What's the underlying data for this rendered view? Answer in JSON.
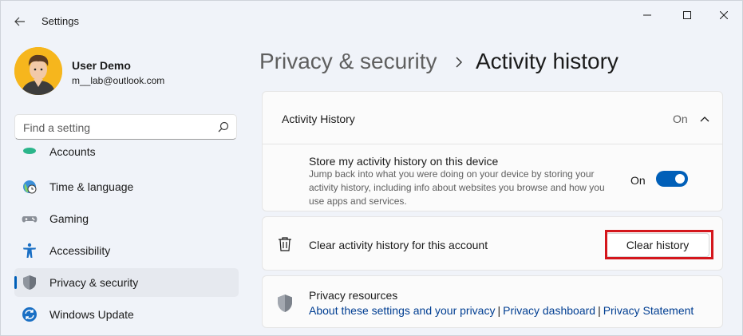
{
  "window": {
    "title": "Settings"
  },
  "profile": {
    "name": "User Demo",
    "email": "m__lab@outlook.com"
  },
  "search": {
    "placeholder": "Find a setting",
    "value": ""
  },
  "sidebar": {
    "items": [
      {
        "label": "Accounts",
        "icon": "accounts-icon",
        "selected": false
      },
      {
        "label": "Time & language",
        "icon": "time-language-icon",
        "selected": false
      },
      {
        "label": "Gaming",
        "icon": "gaming-icon",
        "selected": false
      },
      {
        "label": "Accessibility",
        "icon": "accessibility-icon",
        "selected": false
      },
      {
        "label": "Privacy & security",
        "icon": "shield-icon",
        "selected": true
      },
      {
        "label": "Windows Update",
        "icon": "windows-update-icon",
        "selected": false
      }
    ]
  },
  "breadcrumb": {
    "parent": "Privacy & security",
    "current": "Activity history"
  },
  "activity_section": {
    "title": "Activity History",
    "status": "On",
    "expanded": true
  },
  "store_setting": {
    "title": "Store my activity history on this device",
    "description": "Jump back into what you were doing on your device by storing your activity history, including info about websites you browse and how you use apps and services.",
    "toggle_label": "On",
    "enabled": true
  },
  "clear_setting": {
    "title": "Clear activity history for this account",
    "button_label": "Clear history"
  },
  "privacy_resources": {
    "title": "Privacy resources",
    "links": [
      "About these settings and your privacy",
      "Privacy dashboard",
      "Privacy Statement"
    ]
  },
  "colors": {
    "accent": "#005fb8",
    "highlight": "#d4161c",
    "link": "#003e92"
  }
}
